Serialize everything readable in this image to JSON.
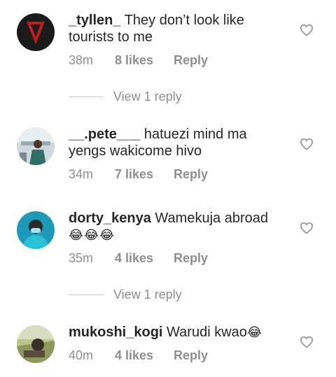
{
  "comments": [
    {
      "username": "_tyllen_",
      "text": "They don’t look like tourists to me",
      "time": "38m",
      "likes": "8 likes",
      "reply": "Reply",
      "view_replies": "View 1 reply"
    },
    {
      "username": "__.pete___",
      "text": "hatuezi mind ma yengs wakicome hivo",
      "time": "34m",
      "likes": "7 likes",
      "reply": "Reply"
    },
    {
      "username": "dorty_kenya",
      "text": "Wamekuja abroad",
      "emoji": "😂😂😂",
      "time": "35m",
      "likes": "4 likes",
      "reply": "Reply",
      "view_replies": "View 1 reply"
    },
    {
      "username": "mukoshi_kogi",
      "text": "Warudi kwao",
      "emoji": "😂",
      "time": "40m",
      "likes": "4 likes",
      "reply": "Reply"
    }
  ],
  "icons": {
    "like": "heart-outline-icon"
  },
  "colors": {
    "text": "#262626",
    "meta": "#8e8e8e"
  }
}
